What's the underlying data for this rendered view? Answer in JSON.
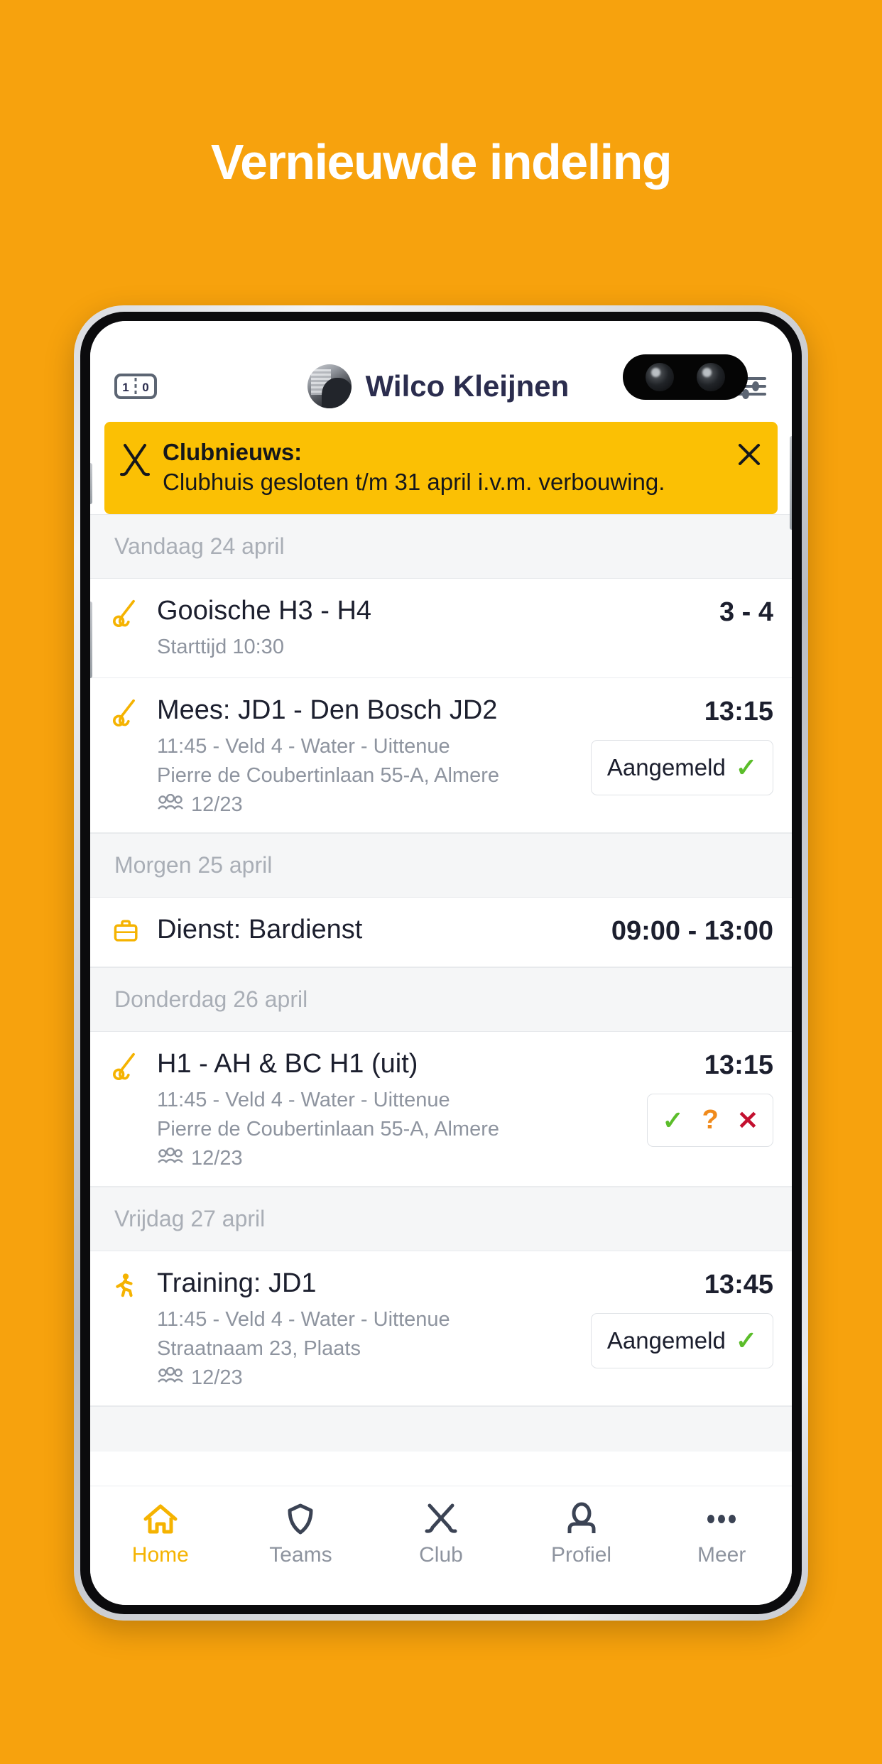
{
  "promo": {
    "headline": "Vernieuwde indeling"
  },
  "colors": {
    "background": "#F7A20D",
    "banner": "#FBC004",
    "accent": "#F5B301",
    "text_dark": "#1C1F2E",
    "text_muted": "#8E949F",
    "check_green": "#5BBD2A",
    "question_orange": "#F08A1B",
    "cross_red": "#C3102F"
  },
  "header": {
    "score_icon": "scoreboard-icon",
    "score_icon_left": "1",
    "score_icon_right": "0",
    "avatar": "user-avatar",
    "user_name": "Wilco Kleijnen",
    "settings_icon": "sliders-icon"
  },
  "news": {
    "icon": "hockey-sticks-icon",
    "title": "Clubnieuws:",
    "text": "Clubhuis gesloten t/m 31 april i.v.m. verbouwing.",
    "close_icon": "close-icon"
  },
  "agenda": [
    {
      "day": "Vandaag 24 april",
      "events": [
        {
          "icon": "hockey-stick-ball-icon",
          "title": "Gooische H3 - H4",
          "sub1": "Starttijd 10:30",
          "sub2": "",
          "attendance": "",
          "time": "3 - 4",
          "action": "none"
        },
        {
          "icon": "hockey-stick-ball-icon",
          "title": "Mees: JD1 - Den Bosch JD2",
          "sub1": "11:45 - Veld 4 - Water - Uittenue",
          "sub2": "Pierre de Coubertinlaan 55-A, Almere",
          "attendance": "12/23",
          "time": "13:15",
          "action": "aangemeld",
          "action_label": "Aangemeld"
        }
      ]
    },
    {
      "day": "Morgen 25 april",
      "events": [
        {
          "icon": "briefcase-icon",
          "title": "Dienst: Bardienst",
          "sub1": "",
          "sub2": "",
          "attendance": "",
          "time": "09:00 - 13:00",
          "action": "none"
        }
      ]
    },
    {
      "day": "Donderdag 26 april",
      "events": [
        {
          "icon": "hockey-stick-ball-icon",
          "title": "H1 - AH & BC H1 (uit)",
          "sub1": "11:45 - Veld 4 - Water - Uittenue",
          "sub2": "Pierre de Coubertinlaan 55-A, Almere",
          "attendance": "12/23",
          "time": "13:15",
          "action": "choice",
          "choice_yes": "✓",
          "choice_maybe": "?",
          "choice_no": "✕"
        }
      ]
    },
    {
      "day": "Vrijdag 27 april",
      "events": [
        {
          "icon": "running-person-icon",
          "title": "Training: JD1",
          "sub1": "11:45 - Veld 4 - Water - Uittenue",
          "sub2": "Straatnaam 23, Plaats",
          "attendance": "12/23",
          "time": "13:45",
          "action": "aangemeld",
          "action_label": "Aangemeld"
        }
      ]
    }
  ],
  "tabbar": [
    {
      "icon": "home-icon",
      "label": "Home",
      "active": true
    },
    {
      "icon": "shield-icon",
      "label": "Teams",
      "active": false
    },
    {
      "icon": "hockey-sticks-icon",
      "label": "Club",
      "active": false
    },
    {
      "icon": "person-icon",
      "label": "Profiel",
      "active": false
    },
    {
      "icon": "more-dots-icon",
      "label": "Meer",
      "active": false
    }
  ]
}
